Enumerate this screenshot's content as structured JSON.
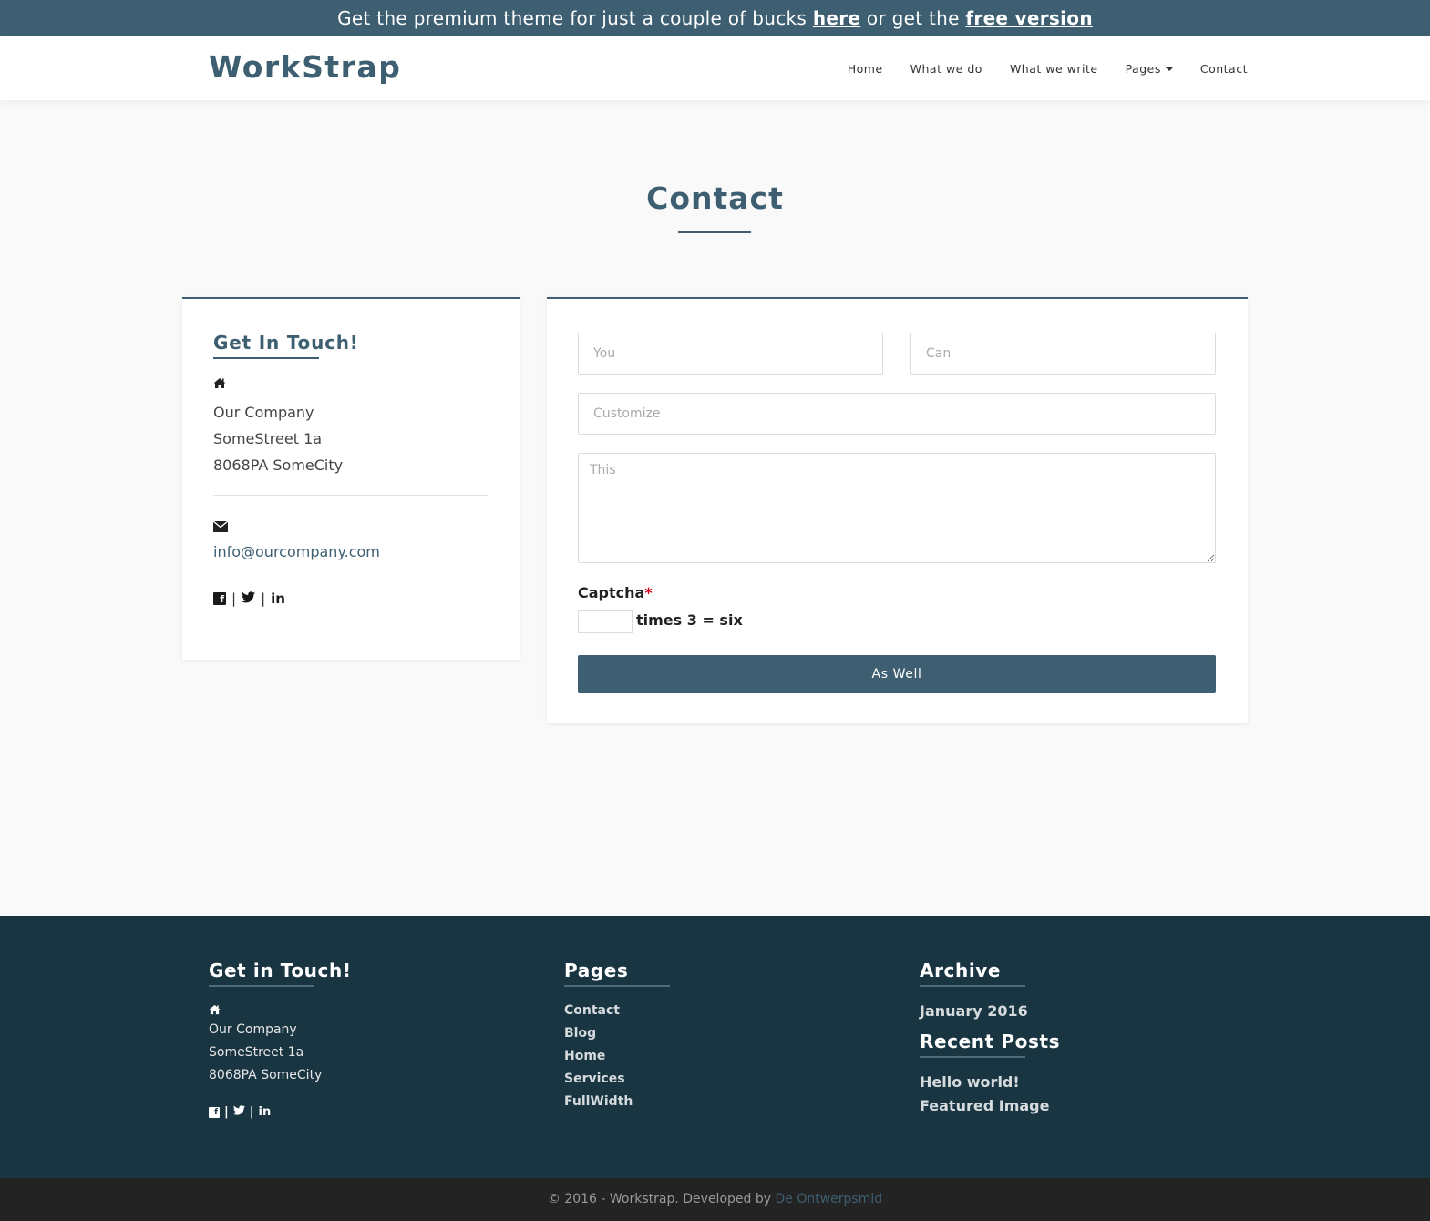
{
  "promo": {
    "text_before": "Get the premium theme for just a couple of bucks ",
    "link_here": "here",
    "text_middle": " or get the ",
    "link_free": "free version"
  },
  "navbar": {
    "brand": "WorkStrap",
    "items": [
      {
        "label": "Home"
      },
      {
        "label": "What we do"
      },
      {
        "label": "What we write"
      },
      {
        "label": "Pages"
      },
      {
        "label": "Contact"
      }
    ]
  },
  "page": {
    "title": "Contact"
  },
  "contact_card": {
    "heading": "Get In Touch!",
    "address": [
      "Our Company",
      "SomeStreet 1a",
      "8068PA SomeCity"
    ],
    "email": "info@ourcompany.com",
    "icons": {
      "home": "home-icon",
      "mail": "envelope-icon"
    }
  },
  "form": {
    "field1_placeholder": "You",
    "field2_placeholder": "Can",
    "field3_placeholder": "Customize",
    "message_placeholder": "This",
    "captcha_label": "Captcha",
    "captcha_required": "*",
    "captcha_question": "times 3 = six",
    "submit_label": "As Well"
  },
  "footer": {
    "col1": {
      "heading": "Get in Touch!",
      "address": [
        "Our Company",
        "SomeStreet 1a",
        "8068PA SomeCity"
      ]
    },
    "col2": {
      "heading": "Pages",
      "links": [
        "Contact",
        "Blog",
        "Home",
        "Services",
        "FullWidth"
      ]
    },
    "col3": {
      "heading": "Archive",
      "archive": [
        "January 2016"
      ],
      "recent_heading": "Recent Posts",
      "recent": [
        "Hello world!",
        "Featured Image"
      ]
    }
  },
  "copyright": {
    "text": "© 2016 - Workstrap. Developed by ",
    "developer": "De Ontwerpsmid"
  },
  "colors": {
    "primary": "#3d5f71",
    "footer_bg": "#1a3542",
    "copyright_bg": "#232323",
    "required": "#d0021b"
  }
}
